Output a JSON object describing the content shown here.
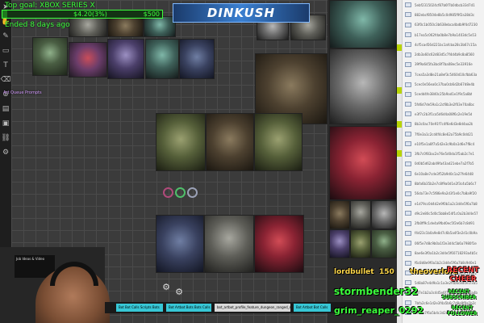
{
  "goal": {
    "label": "Top goal: XBOX SERIES X",
    "current": "$4.20(3%)",
    "target": "$500",
    "progress_fraction": 0.03,
    "ended": "Ended 8 days ago"
  },
  "banner": {
    "text": "DINKUSH"
  },
  "side_tag": {
    "text": "Art Queue Prompts"
  },
  "webcam": {
    "inset_title": "Job Ideas & Video"
  },
  "bottom_tags": [
    "Bot Bot Calls Scripts Bots",
    "Bot Artbot Bots Bots Calls",
    "bot_artbot_profile_feature_dungeon_ranged_simple",
    "Bot Artbot Bot Calls"
  ],
  "alerts": {
    "raid_name": "lordbullet",
    "raid_count": "150",
    "cheer_name": "theoverlord",
    "recent_cheer": "RECENT CHEER",
    "sub_name": "stormbender32",
    "recent_sub": "RECENT SUBSCRIBER",
    "follower_name": "grim_reaper_0292",
    "recent_follower": "RECENT FOLLOWER"
  },
  "file_list": [
    "5ebf2315024cf87b6f7b0dbcb33d7d1",
    "882ebcf8504e8b5c0d985f9f2a38d3c",
    "63f0c1b050c3b638ebca4bdb9f4d7230",
    "b17ea5c062fda0b8e7b9a1403dc5e53",
    "4cf5cad56d221bc1afcba28c3b67c15a",
    "2db3a60c62d83d5c7f4d4b9c8a8560",
    "39f9a645fa3bc8f7ba08ec5e33916e",
    "7cea5a3d8e21a8ef3c5460d10cfbb63a",
    "5cec0e56ea0c37ba0cb6d2b67d8e4b",
    "5cedd4fe3840c25b9ad1e1f9c5a8bf",
    "5fd6d7de59a1c2cf8b3e2f03e70a6bc",
    "e3f7c2b3f1ca5d6d4a08f6c2e19e5d",
    "8b3c0ac70e91f7c4f6e6d3e8d4aa2b",
    "7f0e3a1c2cd4f4c8e62a75b9c0dd21",
    "e10f5e1a8f7a5d2e3c9b0a1d6e7f8c4",
    "3fb7c0f83ac2e76e5d0da1f5ab2c7e1",
    "0d0b5d62ab49fa43ad21ebe7a2f7b5",
    "6e10a8e7cde3f52b9d0c1a27fe6448",
    "8bfa6b35b2e7c8f9a0d1e2f3c4a5b6c7",
    "56da73e7c5f86e9a2d3f1e0c7b8a9f20",
    "e1d79cc0d4d2e9f0b1a2c3d4e5f6a7b8",
    "d9c2e80c5d0c5bb8e54f1c0a2b3d4e57",
    "2fb0ff9c1de4a9fbd0ec5f2e6b7c8d91",
    "f4d23c1b0a9e8d7c6b5a4f3e2d1c0b9a",
    "06f5e7d8c9b0a1f2e3d4c5b6a7980f1e",
    "8ae6e3f0a1b2c3d4e5f60718293a4b5c",
    "f6c8d8e9f0a1b2c3d4e5f6a7b8c9d0e1",
    "0fde7f3c5b9a1d2e4f6081a3b5c7d9e2",
    "5d8a87e4d9a1c1a3e2f4b6c8d0e1f3a5",
    "6d7e1b2a3c4d5e6f7a8b9c0d1e2f3a4b",
    "7bfa2c6e1d2e3f4a5b6c7d8e9f0a1b2c",
    "bc13e7f6a5b4c3d2e1f0a9b8c7d6e5f4"
  ]
}
